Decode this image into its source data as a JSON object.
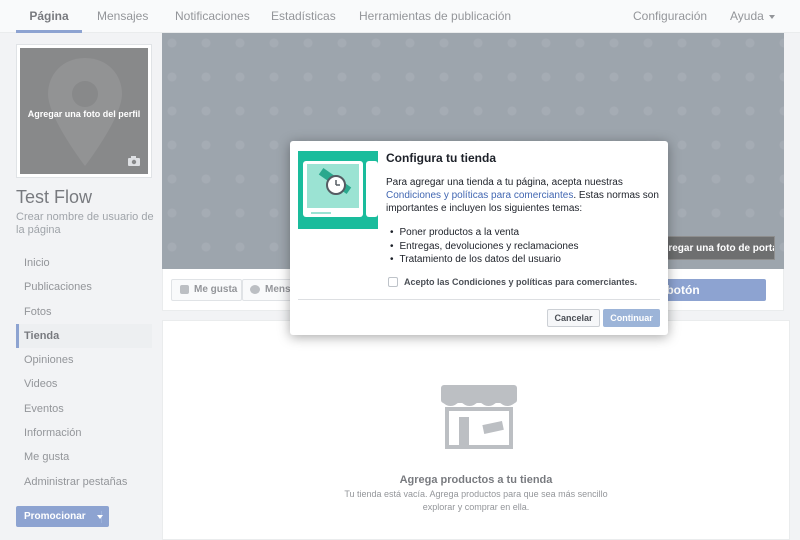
{
  "topnav": {
    "tabs": [
      "Página",
      "Mensajes",
      "Notificaciones",
      "Estadísticas",
      "Herramientas de publicación"
    ],
    "settings": "Configuración",
    "help": "Ayuda"
  },
  "profile": {
    "photo_label": "Agregar una foto del perfil",
    "page_name": "Test Flow",
    "username_hint": "Crear nombre de usuario de la página"
  },
  "sidenav": {
    "items": [
      "Inicio",
      "Publicaciones",
      "Fotos",
      "Tienda",
      "Opiniones",
      "Videos",
      "Eventos",
      "Información",
      "Me gusta",
      "Administrar pestañas"
    ],
    "active": "Tienda"
  },
  "promote_label": "Promocionar",
  "cover": {
    "add_cover_label": "Agregar una foto de portada"
  },
  "actions": {
    "like": "Me gusta",
    "message": "Mensaje",
    "cta": "Agregar un botón"
  },
  "shop": {
    "title": "Agrega productos a tu tienda",
    "description": "Tu tienda está vacía. Agrega productos para que sea más sencillo explorar y comprar en ella."
  },
  "modal": {
    "title": "Configura tu tienda",
    "body_1": "Para agregar una tienda a tu página, acepta nuestras ",
    "body_link": "Condiciones y políticas para comerciantes",
    "body_2": ". Estas normas son importantes e incluyen los siguientes temas:",
    "topics": [
      "Poner productos a la venta",
      "Entregas, devoluciones y reclamaciones",
      "Tratamiento de los datos del usuario"
    ],
    "checkbox_label": "Acepto las Condiciones y políticas para comerciantes.",
    "cancel": "Cancelar",
    "continue": "Continuar"
  },
  "colors": {
    "brand": "#4267b2",
    "modal_art": "#1abc9c"
  }
}
